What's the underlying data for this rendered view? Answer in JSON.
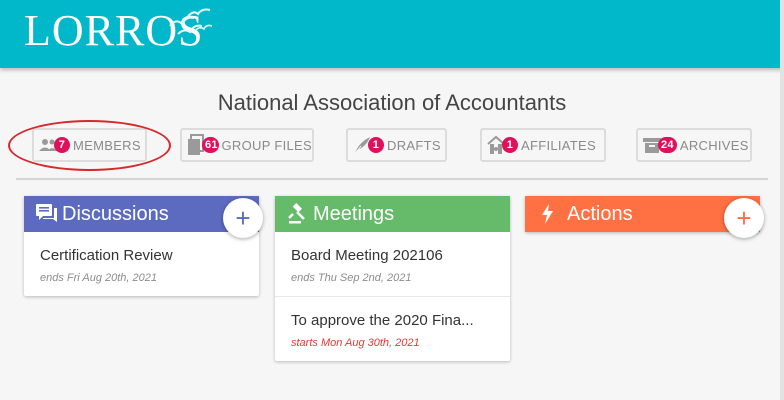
{
  "app": {
    "logo_text": "LORROS"
  },
  "org": {
    "title": "National Association of Accountants"
  },
  "tabs": [
    {
      "label": "MEMBERS",
      "count": "7",
      "icon": "people-icon"
    },
    {
      "label": "GROUP FILES",
      "count": "61",
      "icon": "files-icon"
    },
    {
      "label": "DRAFTS",
      "count": "1",
      "icon": "quill-icon"
    },
    {
      "label": "AFFILIATES",
      "count": "1",
      "icon": "affiliates-icon"
    },
    {
      "label": "ARCHIVES",
      "count": "24",
      "icon": "archive-icon"
    }
  ],
  "panels": {
    "discussions": {
      "title": "Discussions",
      "color": "#5c6bc0",
      "icon": "forum-icon",
      "add_label": "+",
      "items": [
        {
          "title": "Certification Review",
          "date": "ends Fri Aug 20th, 2021"
        }
      ]
    },
    "meetings": {
      "title": "Meetings",
      "color": "#66bb6a",
      "icon": "gavel-icon",
      "add_label": "+",
      "items": [
        {
          "title": "Board Meeting 202106",
          "date": "ends Thu Sep 2nd, 2021"
        },
        {
          "title": "To approve the 2020 Fina...",
          "date": "starts Mon Aug 30th, 2021"
        }
      ]
    },
    "actions": {
      "title": "Actions",
      "color": "#ff7043",
      "icon": "bolt-icon",
      "add_label": "+",
      "items": []
    }
  },
  "colors": {
    "header": "#00b8c9",
    "badge": "#e0105b",
    "highlight": "#d8282a",
    "date_upcoming": "#e53935"
  }
}
